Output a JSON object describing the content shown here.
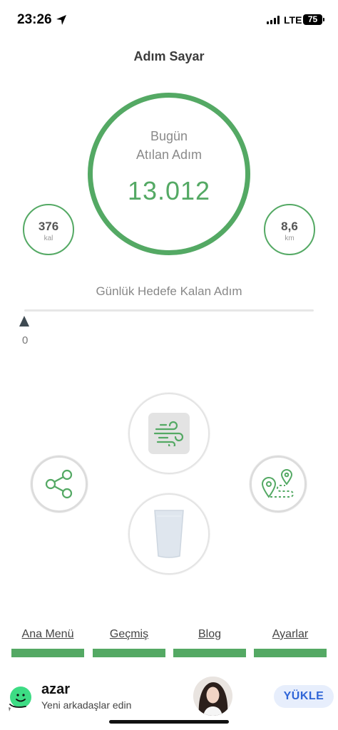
{
  "status_bar": {
    "time": "23:26",
    "network": "LTE",
    "battery": "75"
  },
  "header": {
    "title": "Adım Sayar"
  },
  "steps": {
    "label_line1": "Bugün",
    "label_line2": "Atılan Adım",
    "value": "13.012"
  },
  "calories": {
    "value": "376",
    "unit": "kal"
  },
  "distance": {
    "value": "8,6",
    "unit": "km"
  },
  "goal": {
    "label": "Günlük Hedefe Kalan Adım",
    "remaining": "0",
    "progress_fraction": 0
  },
  "actions": {
    "wind": "wind-icon",
    "water": "water-glass-icon",
    "share": "share-icon",
    "route": "route-map-icon"
  },
  "nav": [
    {
      "label": "Ana Menü"
    },
    {
      "label": "Geçmiş"
    },
    {
      "label": "Blog"
    },
    {
      "label": "Ayarlar"
    }
  ],
  "ad": {
    "title": "azar",
    "subtitle": "Yeni arkadaşlar edin",
    "cta": "YÜKLE"
  },
  "colors": {
    "accent": "#54a964",
    "cta": "#2f65d7",
    "cta_bg": "#e7eefc"
  }
}
